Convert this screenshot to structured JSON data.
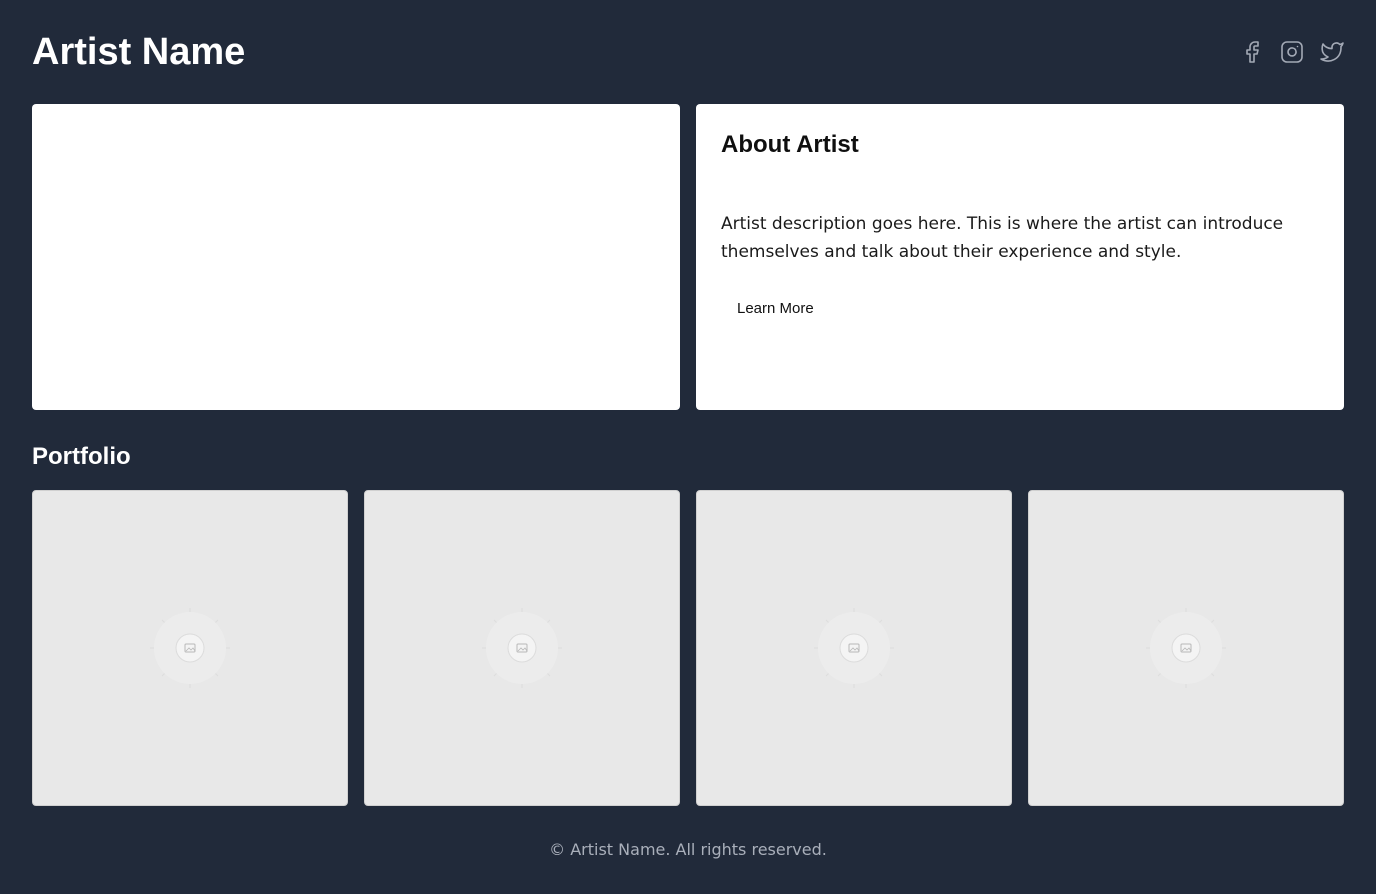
{
  "header": {
    "title": "Artist Name",
    "socials": [
      {
        "icon": "facebook-icon"
      },
      {
        "icon": "instagram-icon"
      },
      {
        "icon": "twitter-icon"
      }
    ]
  },
  "about": {
    "title": "About Artist",
    "description": "Artist description goes here. This is where the artist can introduce themselves and talk about their experience and style.",
    "button_label": "Learn More"
  },
  "portfolio": {
    "heading": "Portfolio",
    "items": [
      {
        "icon": "image-placeholder-icon"
      },
      {
        "icon": "image-placeholder-icon"
      },
      {
        "icon": "image-placeholder-icon"
      },
      {
        "icon": "image-placeholder-icon"
      }
    ]
  },
  "footer": {
    "text": "© Artist Name. All rights reserved."
  },
  "colors": {
    "background": "#212a3a",
    "card": "#ffffff",
    "placeholder": "#e8e8e8",
    "muted_text": "#a9afba"
  }
}
